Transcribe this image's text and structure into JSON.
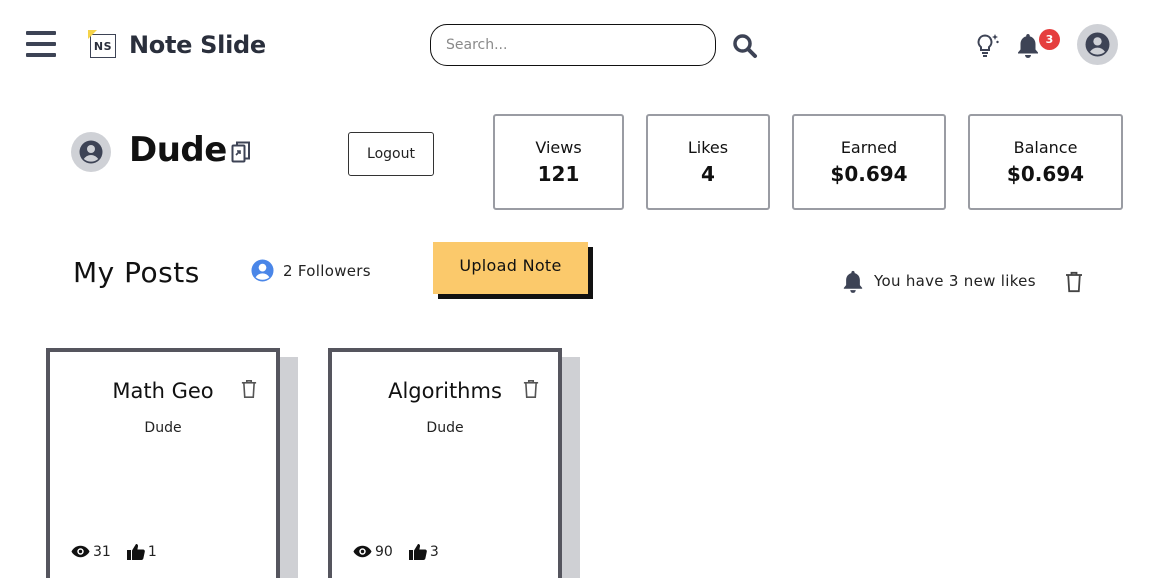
{
  "header": {
    "brand_logo_text": "NS",
    "brand_name": "Note Slide",
    "search_placeholder": "Search...",
    "notification_count": "3",
    "icons": [
      "menu-icon",
      "search-icon",
      "lightbulb-icon",
      "bell-icon",
      "user-avatar-icon"
    ]
  },
  "profile": {
    "name": "Dude",
    "logout_label": "Logout",
    "stats": {
      "views": {
        "label": "Views",
        "value": "121"
      },
      "likes": {
        "label": "Likes",
        "value": "4"
      },
      "earned": {
        "label": "Earned",
        "value": "$0.694"
      },
      "balance": {
        "label": "Balance",
        "value": "$0.694"
      }
    }
  },
  "posts_section": {
    "title": "My Posts",
    "followers_text": "2 Followers",
    "upload_label": "Upload Note",
    "likes_notice": "You have 3 new likes"
  },
  "posts": [
    {
      "title": "Math Geo",
      "author": "Dude",
      "views": "31",
      "likes": "1"
    },
    {
      "title": "Algorithms",
      "author": "Dude",
      "views": "90",
      "likes": "3"
    }
  ],
  "colors": {
    "accent_button": "#fbc96b",
    "badge": "#e53e3e",
    "icon_dark": "#3d4355",
    "followers_icon": "#4a86e8",
    "brand_corner": "#f5d34a"
  }
}
